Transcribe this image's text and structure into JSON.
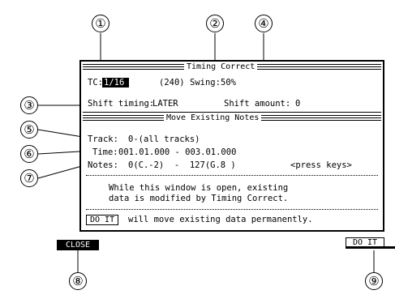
{
  "timing_correct": {
    "title": "Timing Correct",
    "tc_label": "TC:",
    "tc_value": "1/16",
    "tc_ticks": "(240)",
    "swing_label": "Swing:",
    "swing_value": "50%",
    "shift_timing_label": "Shift timing:",
    "shift_timing_value": "LATER",
    "shift_amount_label": "Shift amount:",
    "shift_amount_value": "0"
  },
  "move_existing": {
    "title": "Move Existing Notes",
    "track_label": "Track:",
    "track_value": "0-(all tracks)",
    "time_label": "Time:",
    "time_value": "001.01.000 - 003.01.000",
    "notes_label": "Notes:",
    "notes_value": "0(C.-2)  -  127(G.8 )",
    "notes_hint": "<press keys>",
    "info_line1": "While this window is open, existing",
    "info_line2": "data is modified by Timing Correct.",
    "doit_inline": "DO IT",
    "doit_message": "will move existing data permanently."
  },
  "softkeys": {
    "close": "CLOSE",
    "do_it": "DO IT"
  },
  "callouts": [
    "①",
    "②",
    "③",
    "④",
    "⑤",
    "⑥",
    "⑦",
    "⑧",
    "⑨"
  ]
}
